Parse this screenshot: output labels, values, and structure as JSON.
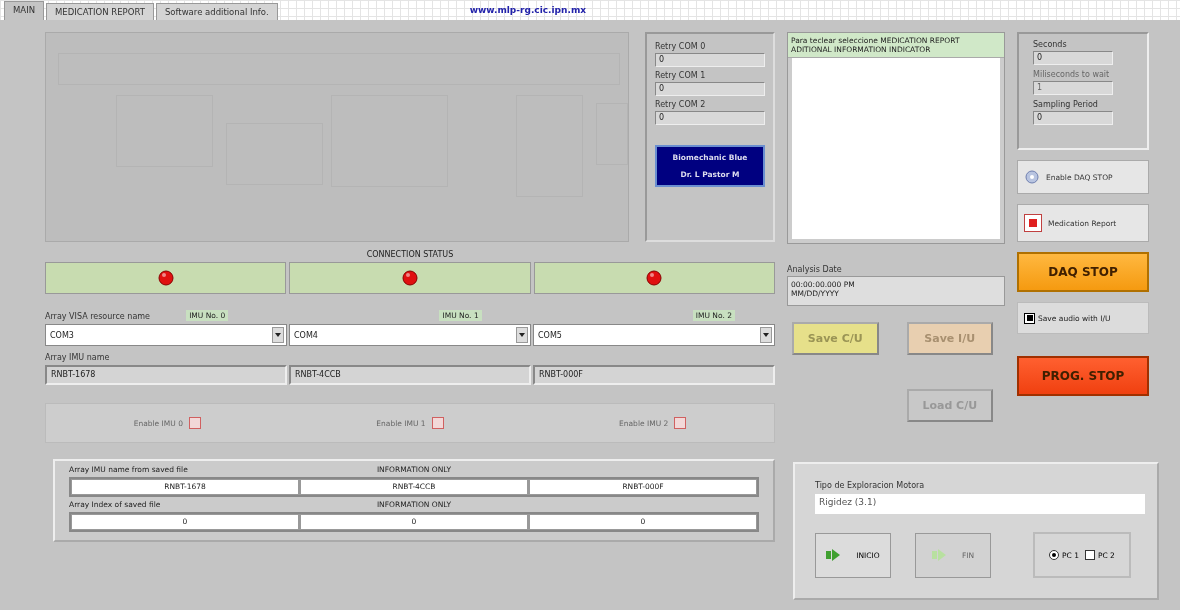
{
  "tabs": [
    {
      "label": "MAIN",
      "selected": true
    },
    {
      "label": "MEDICATION REPORT",
      "selected": false
    },
    {
      "label": "Software additional Info.",
      "selected": false
    }
  ],
  "url": "www.mlp-rg.cic.ipn.mx",
  "com_panel": {
    "retries": [
      {
        "label": "Retry COM 0",
        "value": "0"
      },
      {
        "label": "Retry COM 1",
        "value": "0"
      },
      {
        "label": "Retry COM 2",
        "value": "0"
      }
    ],
    "badge": [
      "Biomechanic Blue",
      "Dr. L Pastor M"
    ]
  },
  "connection_status": {
    "title": "CONNECTION STATUS",
    "leds": [
      {
        "on": false
      },
      {
        "on": false
      },
      {
        "on": false
      }
    ]
  },
  "visa": {
    "label": "Array VISA resource name",
    "imus": [
      "IMU No. 0",
      "IMU No. 1",
      "IMU No. 2"
    ],
    "resources": [
      "COM3",
      "COM4",
      "COM5"
    ]
  },
  "imu_names": {
    "label": "Array IMU name",
    "values": [
      "RNBT-1678",
      "RNBT-4CCB",
      "RNBT-000F"
    ]
  },
  "enable_imus": [
    {
      "label": "Enable IMU 0",
      "checked": false
    },
    {
      "label": "Enable IMU 1",
      "checked": false
    },
    {
      "label": "Enable IMU 2",
      "checked": false
    }
  ],
  "saved": {
    "name_label": "Array IMU name from saved file",
    "name_info": "INFORMATION ONLY",
    "names": [
      "RNBT-1678",
      "RNBT-4CCB",
      "RNBT-000F"
    ],
    "index_label": "Array Index of saved file",
    "index_info": "INFORMATION ONLY",
    "indexes": [
      "0",
      "0",
      "0"
    ]
  },
  "message": {
    "header": "Para teclear seleccione MEDICATION REPORT ADITIONAL INFORMATION INDICATOR"
  },
  "analysis_date": {
    "label": "Analysis Date",
    "lines": [
      "00:00:00.000 PM",
      "MM/DD/YYYY"
    ]
  },
  "file_buttons": [
    {
      "label": "Save C/U",
      "kind": "yellow"
    },
    {
      "label": "Save I/U",
      "kind": "peach"
    },
    {
      "label": "Load C/U",
      "kind": "grey"
    }
  ],
  "timing": [
    {
      "label": "Seconds",
      "value": "0",
      "disabled": false
    },
    {
      "label": "Miliseconds to wait",
      "value": "1",
      "disabled": true
    },
    {
      "label": "Sampling Period",
      "value": "0",
      "disabled": false
    }
  ],
  "enable_daq_stop": "Enable DAQ STOP",
  "medication_report": "Medication Report",
  "daq_stop": "DAQ STOP",
  "save_audio": {
    "label": "Save audio with I/U",
    "checked": true
  },
  "prog_stop": "PROG. STOP",
  "exploration": {
    "label": "Tipo de Exploracion Motora",
    "value": "Rigidez (3.1)",
    "buttons": [
      {
        "label": "INICIO",
        "disabled": false
      },
      {
        "label": "FIN",
        "disabled": true
      }
    ],
    "pcs": [
      {
        "label": "PC 1",
        "selected": true
      },
      {
        "label": "PC 2",
        "selected": false
      }
    ]
  }
}
